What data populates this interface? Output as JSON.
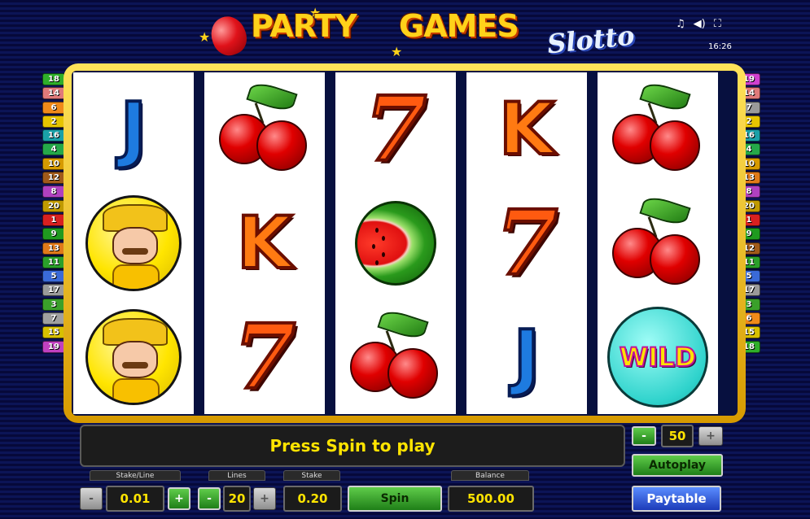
{
  "header": {
    "logo_word1": "PARTY",
    "logo_word2": "GAMES",
    "logo_word3": "Slotto",
    "clock": "16:26",
    "icons": [
      "music-icon",
      "sound-icon",
      "fullscreen-icon"
    ]
  },
  "reels": [
    [
      "J",
      "sheriff",
      "sheriff"
    ],
    [
      "cherries",
      "K",
      "7"
    ],
    [
      "7",
      "watermelon",
      "cherries"
    ],
    [
      "K",
      "7",
      "J"
    ],
    [
      "cherries",
      "cherries",
      "WILD"
    ]
  ],
  "wild_label": "WILD",
  "line_badges": {
    "left": [
      {
        "n": "18",
        "color": "#2fae2a"
      },
      {
        "n": "14",
        "color": "#e07a7a"
      },
      {
        "n": "6",
        "color": "#f08a1a"
      },
      {
        "n": "2",
        "color": "#e6c400"
      },
      {
        "n": "16",
        "color": "#1aa0a8"
      },
      {
        "n": "4",
        "color": "#25a84a"
      },
      {
        "n": "10",
        "color": "#d69a00"
      },
      {
        "n": "12",
        "color": "#a05a1a"
      },
      {
        "n": "8",
        "color": "#b040c0"
      },
      {
        "n": "20",
        "color": "#c09a00"
      },
      {
        "n": "1",
        "color": "#d82020"
      },
      {
        "n": "9",
        "color": "#1f9a1f"
      },
      {
        "n": "13",
        "color": "#e07a1a"
      },
      {
        "n": "11",
        "color": "#2aa02a"
      },
      {
        "n": "5",
        "color": "#3a6ad8"
      },
      {
        "n": "17",
        "color": "#9a9a9a"
      },
      {
        "n": "3",
        "color": "#3aa02a"
      },
      {
        "n": "7",
        "color": "#a0a0a0"
      },
      {
        "n": "15",
        "color": "#d8c000"
      },
      {
        "n": "19",
        "color": "#c040c0"
      }
    ],
    "right": [
      {
        "n": "19",
        "color": "#d040d0"
      },
      {
        "n": "14",
        "color": "#e07a7a"
      },
      {
        "n": "7",
        "color": "#9a9a9a"
      },
      {
        "n": "2",
        "color": "#e6c400"
      },
      {
        "n": "16",
        "color": "#1aa0a8"
      },
      {
        "n": "4",
        "color": "#25a84a"
      },
      {
        "n": "10",
        "color": "#d69a00"
      },
      {
        "n": "13",
        "color": "#e07a1a"
      },
      {
        "n": "8",
        "color": "#b040c0"
      },
      {
        "n": "20",
        "color": "#c09a00"
      },
      {
        "n": "1",
        "color": "#d82020"
      },
      {
        "n": "9",
        "color": "#1f9a1f"
      },
      {
        "n": "12",
        "color": "#a05a1a"
      },
      {
        "n": "11",
        "color": "#2aa02a"
      },
      {
        "n": "5",
        "color": "#3a6ad8"
      },
      {
        "n": "17",
        "color": "#9a9a9a"
      },
      {
        "n": "3",
        "color": "#3aa02a"
      },
      {
        "n": "6",
        "color": "#f08a1a"
      },
      {
        "n": "15",
        "color": "#d8c000"
      },
      {
        "n": "18",
        "color": "#2fae2a"
      }
    ]
  },
  "message": "Press Spin to play",
  "controls": {
    "stake_line_label": "Stake/Line",
    "stake_line_value": "0.01",
    "lines_label": "Lines",
    "lines_value": "20",
    "stake_label": "Stake",
    "stake_value": "0.20",
    "balance_label": "Balance",
    "balance_value": "500.00",
    "spin_label": "Spin",
    "minus_label": "-",
    "plus_label": "+",
    "autoplay_count": "50",
    "autoplay_label": "Autoplay",
    "paytable_label": "Paytable"
  },
  "colors": {
    "message_text": "#ffe400",
    "frame_gold": "#f0c000",
    "button_green": "#2f9a22",
    "paytable_blue": "#2a50d0"
  }
}
